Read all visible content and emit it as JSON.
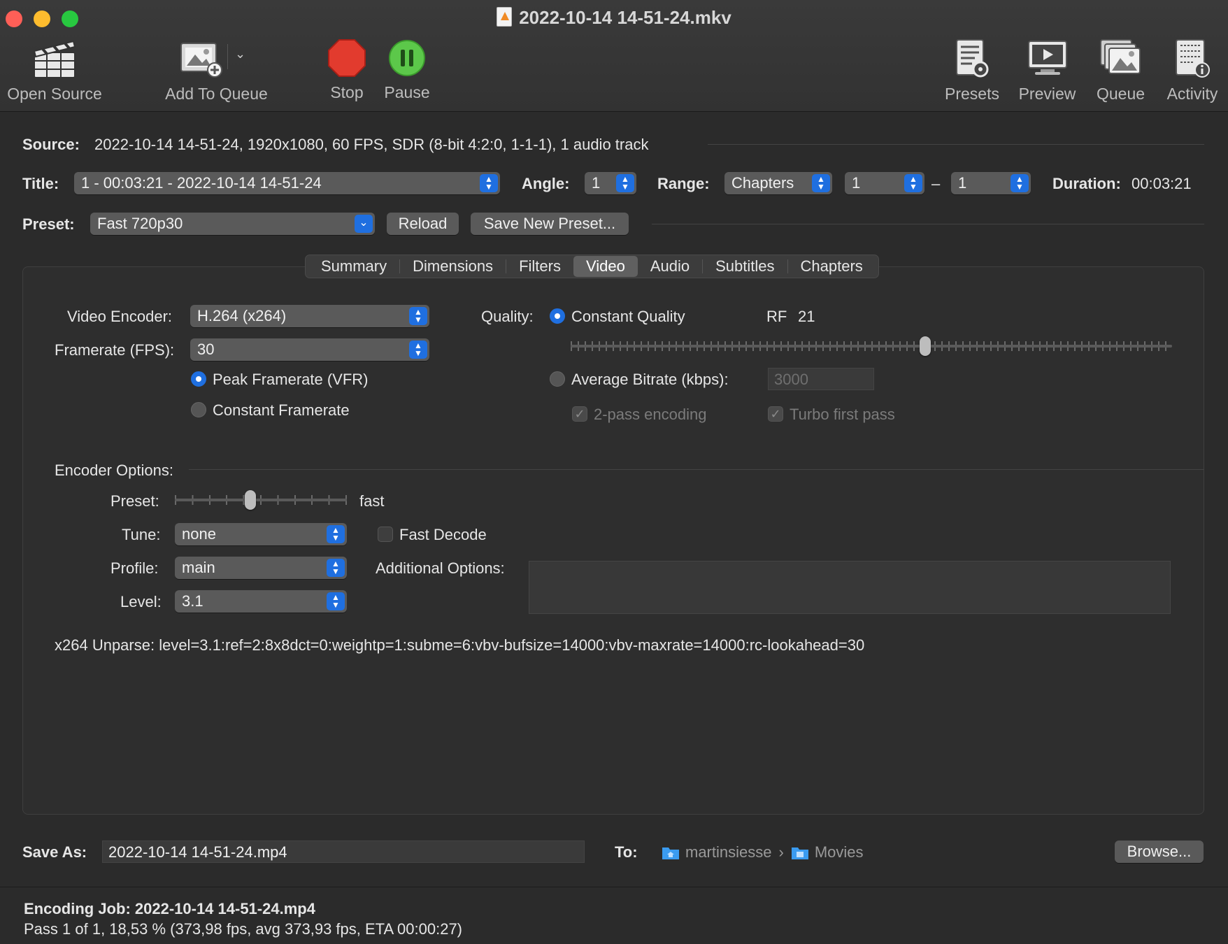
{
  "window": {
    "title": "2022-10-14 14-51-24.mkv",
    "traffic_colors": {
      "close": "#fe5f57",
      "minimize": "#febc2e",
      "zoom": "#28c840"
    }
  },
  "toolbar": {
    "open_source": "Open Source",
    "add_to_queue": "Add To Queue",
    "stop": "Stop",
    "pause": "Pause",
    "presets": "Presets",
    "preview": "Preview",
    "queue": "Queue",
    "activity": "Activity"
  },
  "source": {
    "label": "Source:",
    "value": "2022-10-14 14-51-24, 1920x1080, 60 FPS, SDR (8-bit 4:2:0, 1-1-1), 1 audio track"
  },
  "title_row": {
    "title_label": "Title:",
    "title_value": "1 - 00:03:21 - 2022-10-14 14-51-24",
    "angle_label": "Angle:",
    "angle_value": "1",
    "range_label": "Range:",
    "range_type": "Chapters",
    "range_start": "1",
    "range_dash": "–",
    "range_end": "1",
    "duration_label": "Duration:",
    "duration_value": "00:03:21"
  },
  "preset_row": {
    "label": "Preset:",
    "value": "Fast 720p30",
    "reload": "Reload",
    "save_new": "Save New Preset..."
  },
  "tabs": [
    "Summary",
    "Dimensions",
    "Filters",
    "Video",
    "Audio",
    "Subtitles",
    "Chapters"
  ],
  "active_tab": "Video",
  "video": {
    "encoder_label": "Video Encoder:",
    "encoder_value": "H.264 (x264)",
    "framerate_label": "Framerate (FPS):",
    "framerate_value": "30",
    "peak_framerate": "Peak Framerate (VFR)",
    "constant_framerate": "Constant Framerate",
    "quality_label": "Quality:",
    "constant_quality": "Constant Quality",
    "rf_label": "RF",
    "rf_value": "21",
    "rf_slider_fraction": 0.59,
    "avg_bitrate": "Average Bitrate (kbps):",
    "bitrate_value": "3000",
    "two_pass": "2-pass encoding",
    "turbo": "Turbo first pass"
  },
  "encoder_options": {
    "label": "Encoder Options:",
    "preset_label": "Preset:",
    "preset_value": "fast",
    "preset_slider_fraction": 0.44,
    "tune_label": "Tune:",
    "tune_value": "none",
    "fast_decode": "Fast Decode",
    "profile_label": "Profile:",
    "profile_value": "main",
    "additional_label": "Additional Options:",
    "level_label": "Level:",
    "level_value": "3.1",
    "unparse": "x264 Unparse: level=3.1:ref=2:8x8dct=0:weightp=1:subme=6:vbv-bufsize=14000:vbv-maxrate=14000:rc-lookahead=30"
  },
  "save": {
    "label": "Save As:",
    "value": "2022-10-14 14-51-24.mp4",
    "to_label": "To:",
    "path_1": "martinsiesse",
    "path_sep": "›",
    "path_2": "Movies",
    "browse": "Browse..."
  },
  "status": {
    "job": "Encoding Job: 2022-10-14 14-51-24.mp4",
    "progress": "Pass 1 of 1, 18,53 % (373,98 fps, avg 373,93 fps, ETA 00:00:27)"
  }
}
